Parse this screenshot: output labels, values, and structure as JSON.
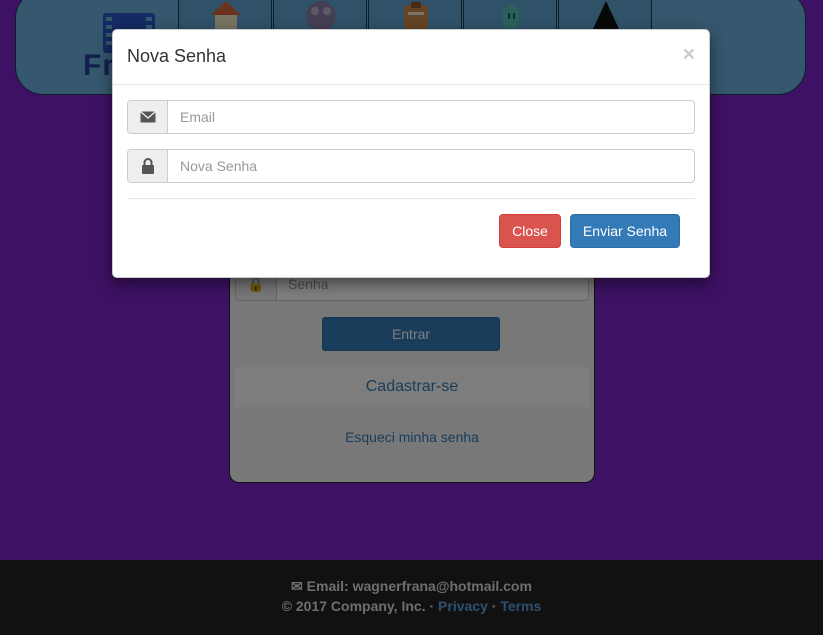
{
  "header": {
    "logo_text": "Frana",
    "nav_items": [
      {
        "icon": "house-icon"
      },
      {
        "icon": "film-reel-icon"
      },
      {
        "icon": "clipboard-icon"
      },
      {
        "icon": "user-icon"
      },
      {
        "icon": "mask-icon"
      }
    ]
  },
  "login": {
    "password_placeholder": "Senha",
    "enter_label": "Entrar",
    "register_label": "Cadastrar-se",
    "forgot_label": "Esqueci minha senha"
  },
  "modal": {
    "title": "Nova Senha",
    "close_symbol": "×",
    "email_placeholder": "Email",
    "password_placeholder": "Nova Senha",
    "close_label": "Close",
    "send_label": "Enviar Senha"
  },
  "footer": {
    "email_line": "Email: wagnerfrana@hotmail.com",
    "copyright": "© 2017 Company, Inc.",
    "separator": "·",
    "privacy": "Privacy",
    "terms": "Terms"
  },
  "colors": {
    "background": "#7a22c6",
    "primary": "#337ab7",
    "danger": "#d9534f",
    "header": "#6ab0dc",
    "footer": "#222222"
  }
}
